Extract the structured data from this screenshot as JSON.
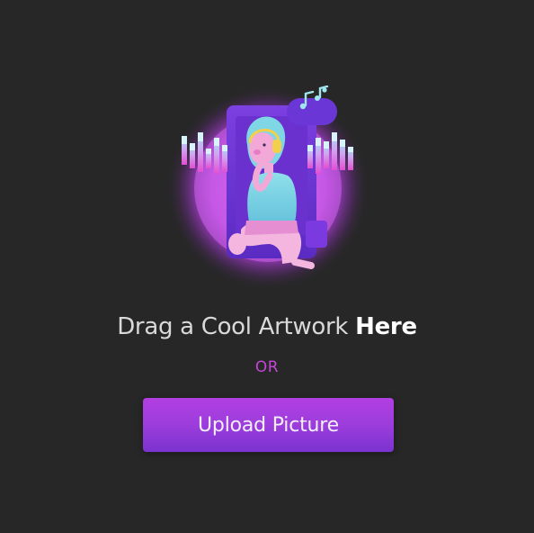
{
  "dropzone": {
    "heading_prefix": "Drag a Cool Artwork ",
    "heading_strong": "Here",
    "or_text": "OR",
    "upload_label": "Upload Picture"
  },
  "artwork": {
    "icon": "music-listener-illustration-icon",
    "note_icon": "music-note-icon"
  },
  "colors": {
    "background": "#272727",
    "accent": "#a53ee0",
    "or_text": "#c445d6",
    "heading": "#d9d9d9"
  }
}
